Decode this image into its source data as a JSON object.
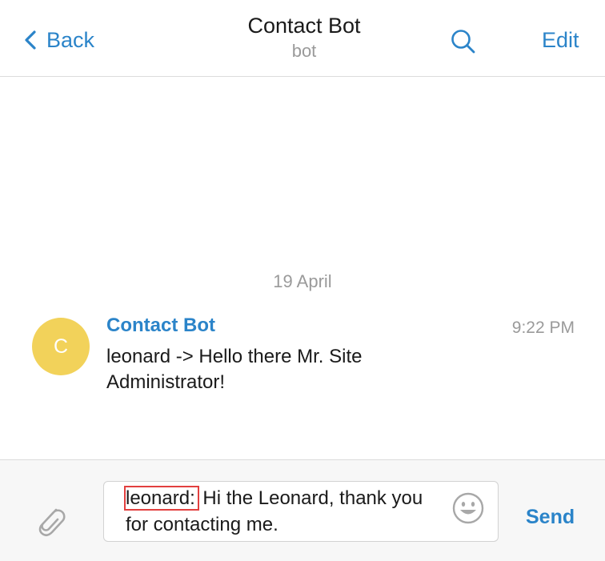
{
  "header": {
    "back_label": "Back",
    "title": "Contact Bot",
    "subtitle": "bot",
    "edit_label": "Edit",
    "icons": {
      "back": "chevron-left-icon",
      "search": "search-icon"
    }
  },
  "chat": {
    "date_separator": "19 April",
    "messages": [
      {
        "avatar_letter": "C",
        "sender": "Contact Bot",
        "time": "9:22 PM",
        "text": "leonard -> Hello there Mr. Site Administrator!"
      }
    ]
  },
  "composer": {
    "mention": "leonard:",
    "text": " Hi the Leonard, thank you for contacting me.",
    "send_label": "Send",
    "icons": {
      "attach": "paperclip-icon",
      "emoji": "emoji-icon"
    }
  },
  "colors": {
    "accent": "#2b84c9",
    "avatar": "#f2d25a",
    "highlight": "#e2403f",
    "muted": "#9a9a9a"
  }
}
